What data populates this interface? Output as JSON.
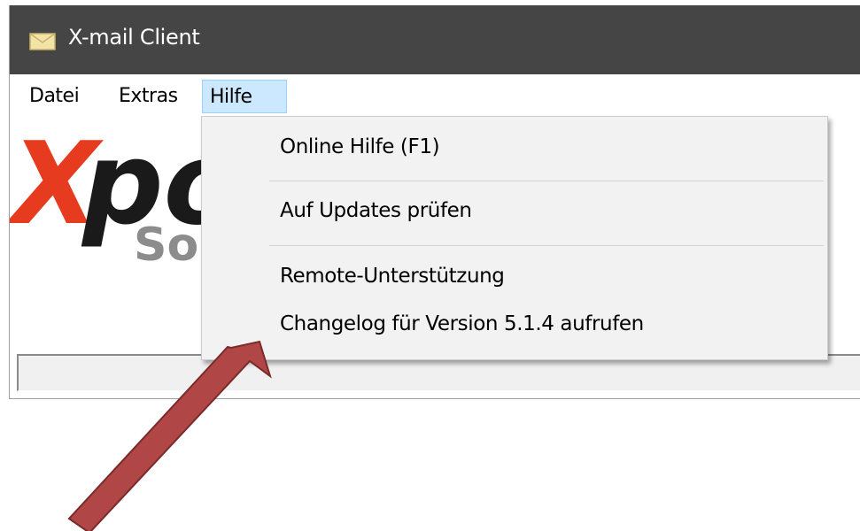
{
  "window": {
    "title": "X-mail Client",
    "icon": "envelope-icon"
  },
  "menubar": {
    "items": [
      {
        "label": "Datei"
      },
      {
        "label": "Extras"
      },
      {
        "label": "Hilfe"
      }
    ],
    "active": "Hilfe"
  },
  "logo": {
    "text": "Xpo",
    "subtext": "So",
    "colors": {
      "red": "#e63b1e",
      "dark": "#1a1a1a",
      "gray": "#8c8c8c"
    }
  },
  "help_menu": {
    "items": [
      {
        "label": "Online Hilfe (F1)"
      },
      {
        "label": "Auf Updates prüfen"
      },
      {
        "label": "Remote-Unterstützung"
      },
      {
        "label": "Changelog für Version 5.1.4 aufrufen"
      }
    ]
  },
  "annotation": {
    "arrow_color": "#b04646",
    "icon": "arrow-annotation-icon"
  },
  "colors": {
    "titlebar": "#454545",
    "menu_highlight": "#cce8ff",
    "dropdown_bg": "#f2f2f2"
  }
}
